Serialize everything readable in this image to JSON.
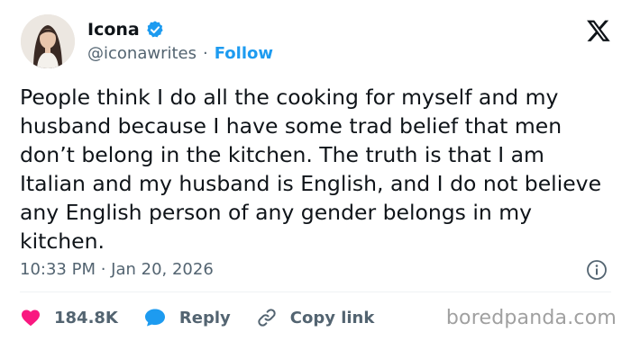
{
  "author": {
    "name": "Icona",
    "handle": "@iconawrites",
    "separator": "·",
    "follow_label": "Follow",
    "verified_color": "#1d9bf0"
  },
  "post": {
    "text": "People think I do all the cooking for myself and my husband because I have some trad belief that men don’t belong in the kitchen. The truth is that I am Italian and my husband is English, and I do not believe any English person of any gender belongs in my kitchen.",
    "timestamp": "10:33 PM · Jan 20, 2026"
  },
  "actions": {
    "like_count": "184.8K",
    "reply_label": "Reply",
    "copy_link_label": "Copy link"
  },
  "icons": {
    "brand": "x-logo-icon",
    "info": "info-icon",
    "like": "heart-icon",
    "reply": "speech-bubble-icon",
    "copy": "link-icon"
  },
  "colors": {
    "accent": "#1d9bf0",
    "like": "#f91880",
    "text": "#0f1419",
    "muted": "#536471"
  },
  "watermark": "boredpanda.com"
}
